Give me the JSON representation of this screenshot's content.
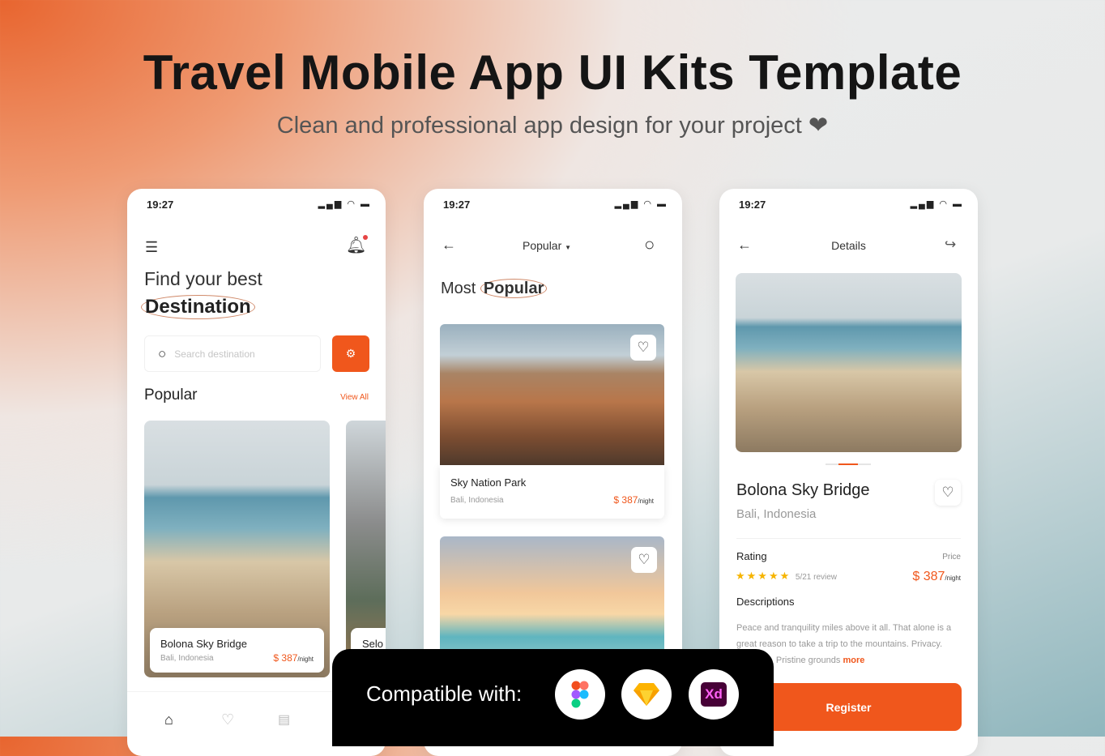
{
  "header": {
    "title": "Travel Mobile App UI Kits Template",
    "subtitle": "Clean and professional app design for your project",
    "subtitle_icon": "heart-icon"
  },
  "status_time": "19:27",
  "accent": "#f0571c",
  "home": {
    "heading_line1": "Find your best",
    "heading_line2": "Destination",
    "search_placeholder": "Search destination",
    "section": "Popular",
    "view_all": "View All",
    "cards": [
      {
        "name": "Bolona Sky Bridge",
        "location": "Bali, Indonesia",
        "price": "$ 387",
        "unit": "/night"
      },
      {
        "name": "Selo"
      }
    ],
    "nav": [
      "home-icon",
      "heart-icon",
      "document-icon"
    ]
  },
  "popular": {
    "dropdown": "Popular",
    "heading_plain": "Most ",
    "heading_bold": "Popular",
    "cards": [
      {
        "name": "Sky Nation Park",
        "location": "Bali, Indonesia",
        "price": "$ 387",
        "unit": "/night"
      }
    ]
  },
  "details": {
    "title": "Details",
    "name": "Bolona Sky Bridge",
    "location": "Bali, Indonesia",
    "rating_label": "Rating",
    "rating": 5,
    "reviews": "5/21 review",
    "price_label": "Price",
    "price": "$ 387",
    "unit": "/night",
    "desc_label": "Descriptions",
    "description": "Peace and tranquility miles above it all. That alone is a great reason to take a trip to the mountains. Privacy. Fresh air. Pristine grounds",
    "more": "more",
    "register": "Register"
  },
  "compatible": {
    "label": "Compatible with:",
    "tools": [
      "Figma",
      "Sketch",
      "Xd"
    ]
  }
}
